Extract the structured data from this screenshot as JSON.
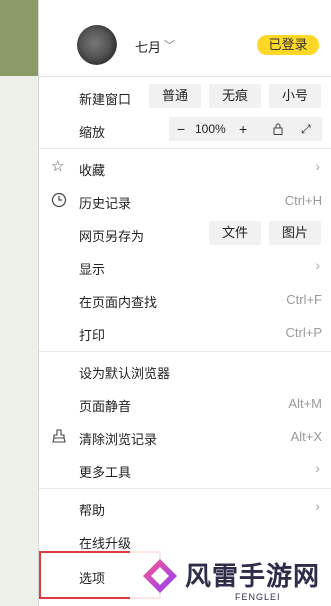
{
  "profile": {
    "username": "七月",
    "login_label": "已登录"
  },
  "menu": {
    "new_window": {
      "label": "新建窗口",
      "options": [
        "普通",
        "无痕",
        "小号"
      ]
    },
    "zoom": {
      "label": "缩放",
      "minus": "−",
      "value": "100%",
      "plus": "+"
    },
    "favorites": {
      "label": "收藏"
    },
    "history": {
      "label": "历史记录",
      "shortcut": "Ctrl+H"
    },
    "save_page": {
      "label": "网页另存为",
      "options": [
        "文件",
        "图片"
      ]
    },
    "display": {
      "label": "显示"
    },
    "find": {
      "label": "在页面内查找",
      "shortcut": "Ctrl+F"
    },
    "print": {
      "label": "打印",
      "shortcut": "Ctrl+P"
    },
    "default_browser": {
      "label": "设为默认浏览器"
    },
    "mute": {
      "label": "页面静音",
      "shortcut": "Alt+M"
    },
    "clear_history": {
      "label": "清除浏览记录",
      "shortcut": "Alt+X"
    },
    "more_tools": {
      "label": "更多工具"
    },
    "help": {
      "label": "帮助"
    },
    "upgrade": {
      "label": "在线升级"
    },
    "options": {
      "label": "选项"
    }
  },
  "watermark": {
    "text": "风雷手游网",
    "sub": "FENGLEI"
  },
  "colors": {
    "login_bg": "#ffd726",
    "highlight": "#e0393e"
  }
}
